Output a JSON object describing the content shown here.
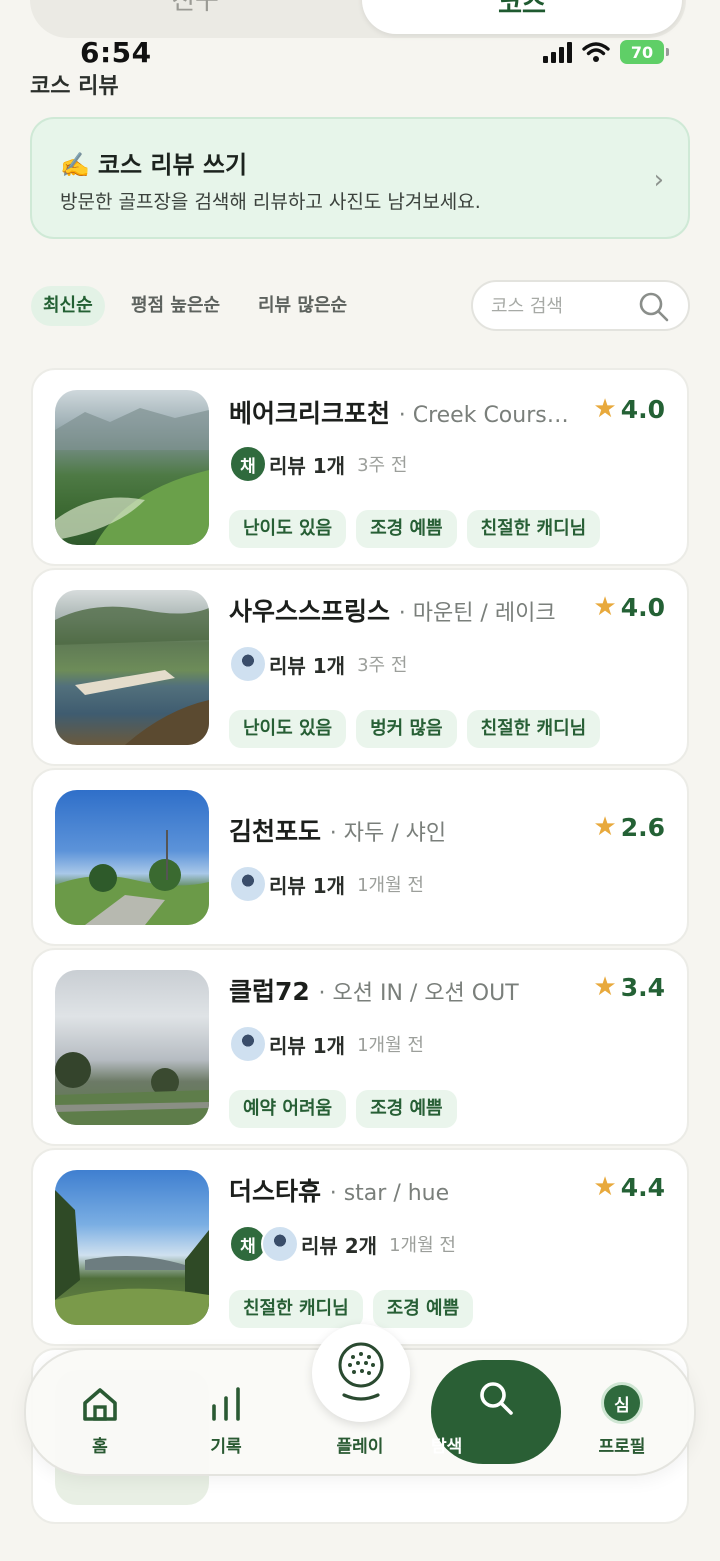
{
  "top_segment": {
    "left_tab": "친구",
    "right_tab": "코스"
  },
  "status_bar": {
    "time": "6:54",
    "battery": "70"
  },
  "page_title": "코스 리뷰",
  "banner": {
    "emoji": "✍️",
    "title": "코스 리뷰 쓰기",
    "subtitle": "방문한 골프장을 검색해 리뷰하고 사진도 남겨보세요.",
    "chevron": "›"
  },
  "sort": {
    "latest": "최신순",
    "top_rated": "평점 높은순",
    "most_reviews": "리뷰 많은순"
  },
  "search": {
    "placeholder": "코스 검색"
  },
  "courses": [
    {
      "name": "베어크리크포천",
      "sub": "· Creek Cours…",
      "rating": "4.0",
      "avatars": [
        {
          "type": "letter",
          "label": "채"
        }
      ],
      "reviews": "리뷰 1개",
      "time": "3주 전",
      "tags": [
        "난이도 있음",
        "조경 예쁨",
        "친절한 캐디님"
      ]
    },
    {
      "name": "사우스스프링스",
      "sub": "· 마운틴 / 레이크",
      "rating": "4.0",
      "avatars": [
        {
          "type": "photo",
          "label": ""
        }
      ],
      "reviews": "리뷰 1개",
      "time": "3주 전",
      "tags": [
        "난이도 있음",
        "벙커 많음",
        "친절한 캐디님"
      ]
    },
    {
      "name": "김천포도",
      "sub": "· 자두 / 샤인",
      "rating": "2.6",
      "avatars": [
        {
          "type": "photo",
          "label": ""
        }
      ],
      "reviews": "리뷰 1개",
      "time": "1개월 전",
      "tags": []
    },
    {
      "name": "클럽72",
      "sub": "· 오션 IN / 오션 OUT",
      "rating": "3.4",
      "avatars": [
        {
          "type": "photo",
          "label": ""
        }
      ],
      "reviews": "리뷰 1개",
      "time": "1개월 전",
      "tags": [
        "예약 어려움",
        "조경 예쁨"
      ]
    },
    {
      "name": "더스타휴",
      "sub": "· star / hue",
      "rating": "4.4",
      "avatars": [
        {
          "type": "letter",
          "label": "채"
        },
        {
          "type": "photo",
          "label": ""
        }
      ],
      "reviews": "리뷰 2개",
      "time": "1개월 전",
      "tags": [
        "친절한 캐디님",
        "조경 예쁨"
      ]
    }
  ],
  "nav": {
    "home": "홈",
    "records": "기록",
    "play": "플레이",
    "explore": "탐색",
    "profile": "프로필",
    "profile_initial": "심"
  },
  "colors": {
    "accent": "#2a5f35",
    "star": "#e8a93c",
    "tag_bg": "#eaf5ec",
    "banner_bg": "#e7f5ea"
  }
}
